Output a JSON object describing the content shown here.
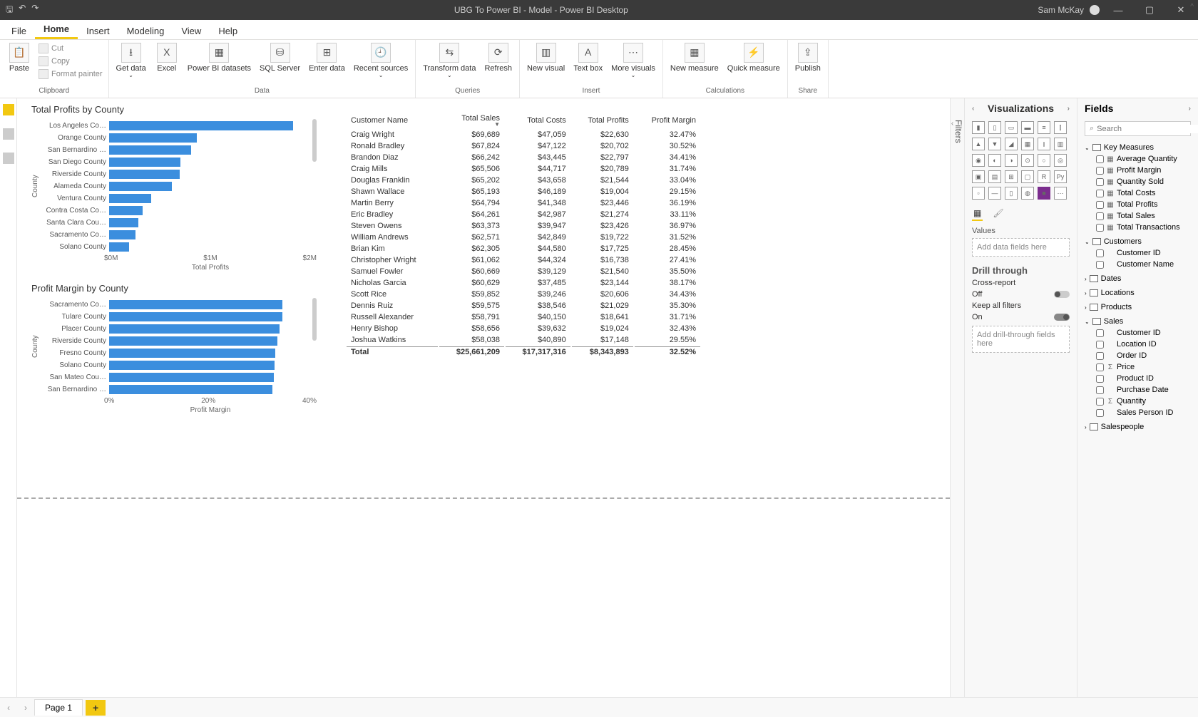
{
  "titlebar": {
    "title": "UBG To Power BI - Model - Power BI Desktop",
    "user": "Sam McKay"
  },
  "tabs": {
    "file": "File",
    "home": "Home",
    "insert": "Insert",
    "modeling": "Modeling",
    "view": "View",
    "help": "Help"
  },
  "ribbon": {
    "clipboard": {
      "label": "Clipboard",
      "paste": "Paste",
      "cut": "Cut",
      "copy": "Copy",
      "format_painter": "Format painter"
    },
    "data": {
      "label": "Data",
      "get_data": "Get data",
      "excel": "Excel",
      "pbi_datasets": "Power BI datasets",
      "sql": "SQL Server",
      "enter": "Enter data",
      "recent": "Recent sources"
    },
    "queries": {
      "label": "Queries",
      "transform": "Transform data",
      "refresh": "Refresh"
    },
    "insert": {
      "label": "Insert",
      "new_visual": "New visual",
      "text_box": "Text box",
      "more": "More visuals"
    },
    "calc": {
      "label": "Calculations",
      "new_measure": "New measure",
      "quick": "Quick measure"
    },
    "share": {
      "label": "Share",
      "publish": "Publish"
    }
  },
  "chart1": {
    "title": "Total Profits by County",
    "ylabel": "County",
    "xlabel": "Total Profits",
    "xticks": [
      "$0M",
      "$1M",
      "$2M"
    ]
  },
  "chart2": {
    "title": "Profit Margin by County",
    "ylabel": "County",
    "xlabel": "Profit Margin",
    "xticks": [
      "0%",
      "20%",
      "40%"
    ]
  },
  "chart_data": [
    {
      "type": "bar",
      "title": "Total Profits by County",
      "xlabel": "Total Profits",
      "ylabel": "County",
      "xlim": [
        0,
        2000000
      ],
      "categories": [
        "Los Angeles Co…",
        "Orange County",
        "San Bernardino …",
        "San Diego County",
        "Riverside County",
        "Alameda County",
        "Ventura County",
        "Contra Costa Co…",
        "Santa Clara Cou…",
        "Sacramento Co…",
        "Solano County"
      ],
      "values": [
        1820000,
        870000,
        810000,
        710000,
        700000,
        620000,
        420000,
        330000,
        290000,
        260000,
        200000
      ]
    },
    {
      "type": "bar",
      "title": "Profit Margin by County",
      "xlabel": "Profit Margin",
      "ylabel": "County",
      "xlim": [
        0,
        40
      ],
      "categories": [
        "Sacramento Co…",
        "Tulare County",
        "Placer County",
        "Riverside County",
        "Fresno County",
        "Solano County",
        "San Mateo Cou…",
        "San Bernardino …"
      ],
      "values": [
        34.4,
        34.3,
        33.7,
        33.4,
        33.0,
        32.8,
        32.6,
        32.4
      ]
    }
  ],
  "table": {
    "headers": [
      "Customer Name",
      "Total Sales",
      "Total Costs",
      "Total Profits",
      "Profit Margin"
    ],
    "rows": [
      [
        "Craig Wright",
        "$69,689",
        "$47,059",
        "$22,630",
        "32.47%"
      ],
      [
        "Ronald Bradley",
        "$67,824",
        "$47,122",
        "$20,702",
        "30.52%"
      ],
      [
        "Brandon Diaz",
        "$66,242",
        "$43,445",
        "$22,797",
        "34.41%"
      ],
      [
        "Craig Mills",
        "$65,506",
        "$44,717",
        "$20,789",
        "31.74%"
      ],
      [
        "Douglas Franklin",
        "$65,202",
        "$43,658",
        "$21,544",
        "33.04%"
      ],
      [
        "Shawn Wallace",
        "$65,193",
        "$46,189",
        "$19,004",
        "29.15%"
      ],
      [
        "Martin Berry",
        "$64,794",
        "$41,348",
        "$23,446",
        "36.19%"
      ],
      [
        "Eric Bradley",
        "$64,261",
        "$42,987",
        "$21,274",
        "33.11%"
      ],
      [
        "Steven Owens",
        "$63,373",
        "$39,947",
        "$23,426",
        "36.97%"
      ],
      [
        "William Andrews",
        "$62,571",
        "$42,849",
        "$19,722",
        "31.52%"
      ],
      [
        "Brian Kim",
        "$62,305",
        "$44,580",
        "$17,725",
        "28.45%"
      ],
      [
        "Christopher Wright",
        "$61,062",
        "$44,324",
        "$16,738",
        "27.41%"
      ],
      [
        "Samuel Fowler",
        "$60,669",
        "$39,129",
        "$21,540",
        "35.50%"
      ],
      [
        "Nicholas Garcia",
        "$60,629",
        "$37,485",
        "$23,144",
        "38.17%"
      ],
      [
        "Scott Rice",
        "$59,852",
        "$39,246",
        "$20,606",
        "34.43%"
      ],
      [
        "Dennis Ruiz",
        "$59,575",
        "$38,546",
        "$21,029",
        "35.30%"
      ],
      [
        "Russell Alexander",
        "$58,791",
        "$40,150",
        "$18,641",
        "31.71%"
      ],
      [
        "Henry Bishop",
        "$58,656",
        "$39,632",
        "$19,024",
        "32.43%"
      ],
      [
        "Joshua Watkins",
        "$58,038",
        "$40,890",
        "$17,148",
        "29.55%"
      ]
    ],
    "total_label": "Total",
    "totals": [
      "$25,661,209",
      "$17,317,316",
      "$8,343,893",
      "32.52%"
    ]
  },
  "viz": {
    "title": "Visualizations",
    "values_label": "Values",
    "values_placeholder": "Add data fields here",
    "drill_title": "Drill through",
    "cross_report": "Cross-report",
    "off": "Off",
    "keep_filters": "Keep all filters",
    "on": "On",
    "drill_placeholder": "Add drill-through fields here"
  },
  "filters": {
    "label": "Filters"
  },
  "fields": {
    "title": "Fields",
    "search_placeholder": "Search",
    "tables": [
      {
        "name": "Key Measures",
        "expanded": true,
        "fields": [
          {
            "name": "Average Quantity",
            "icon": "▦"
          },
          {
            "name": "Profit Margin",
            "icon": "▦"
          },
          {
            "name": "Quantity Sold",
            "icon": "▦"
          },
          {
            "name": "Total Costs",
            "icon": "▦"
          },
          {
            "name": "Total Profits",
            "icon": "▦"
          },
          {
            "name": "Total Sales",
            "icon": "▦"
          },
          {
            "name": "Total Transactions",
            "icon": "▦"
          }
        ]
      },
      {
        "name": "Customers",
        "expanded": true,
        "fields": [
          {
            "name": "Customer ID",
            "icon": ""
          },
          {
            "name": "Customer Name",
            "icon": ""
          }
        ]
      },
      {
        "name": "Dates",
        "expanded": false,
        "fields": []
      },
      {
        "name": "Locations",
        "expanded": false,
        "fields": []
      },
      {
        "name": "Products",
        "expanded": false,
        "fields": []
      },
      {
        "name": "Sales",
        "expanded": true,
        "fields": [
          {
            "name": "Customer ID",
            "icon": ""
          },
          {
            "name": "Location ID",
            "icon": ""
          },
          {
            "name": "Order ID",
            "icon": ""
          },
          {
            "name": "Price",
            "icon": "Σ"
          },
          {
            "name": "Product ID",
            "icon": ""
          },
          {
            "name": "Purchase Date",
            "icon": ""
          },
          {
            "name": "Quantity",
            "icon": "Σ"
          },
          {
            "name": "Sales Person ID",
            "icon": ""
          }
        ]
      },
      {
        "name": "Salespeople",
        "expanded": false,
        "fields": []
      }
    ]
  },
  "page_tabs": {
    "page1": "Page 1"
  }
}
